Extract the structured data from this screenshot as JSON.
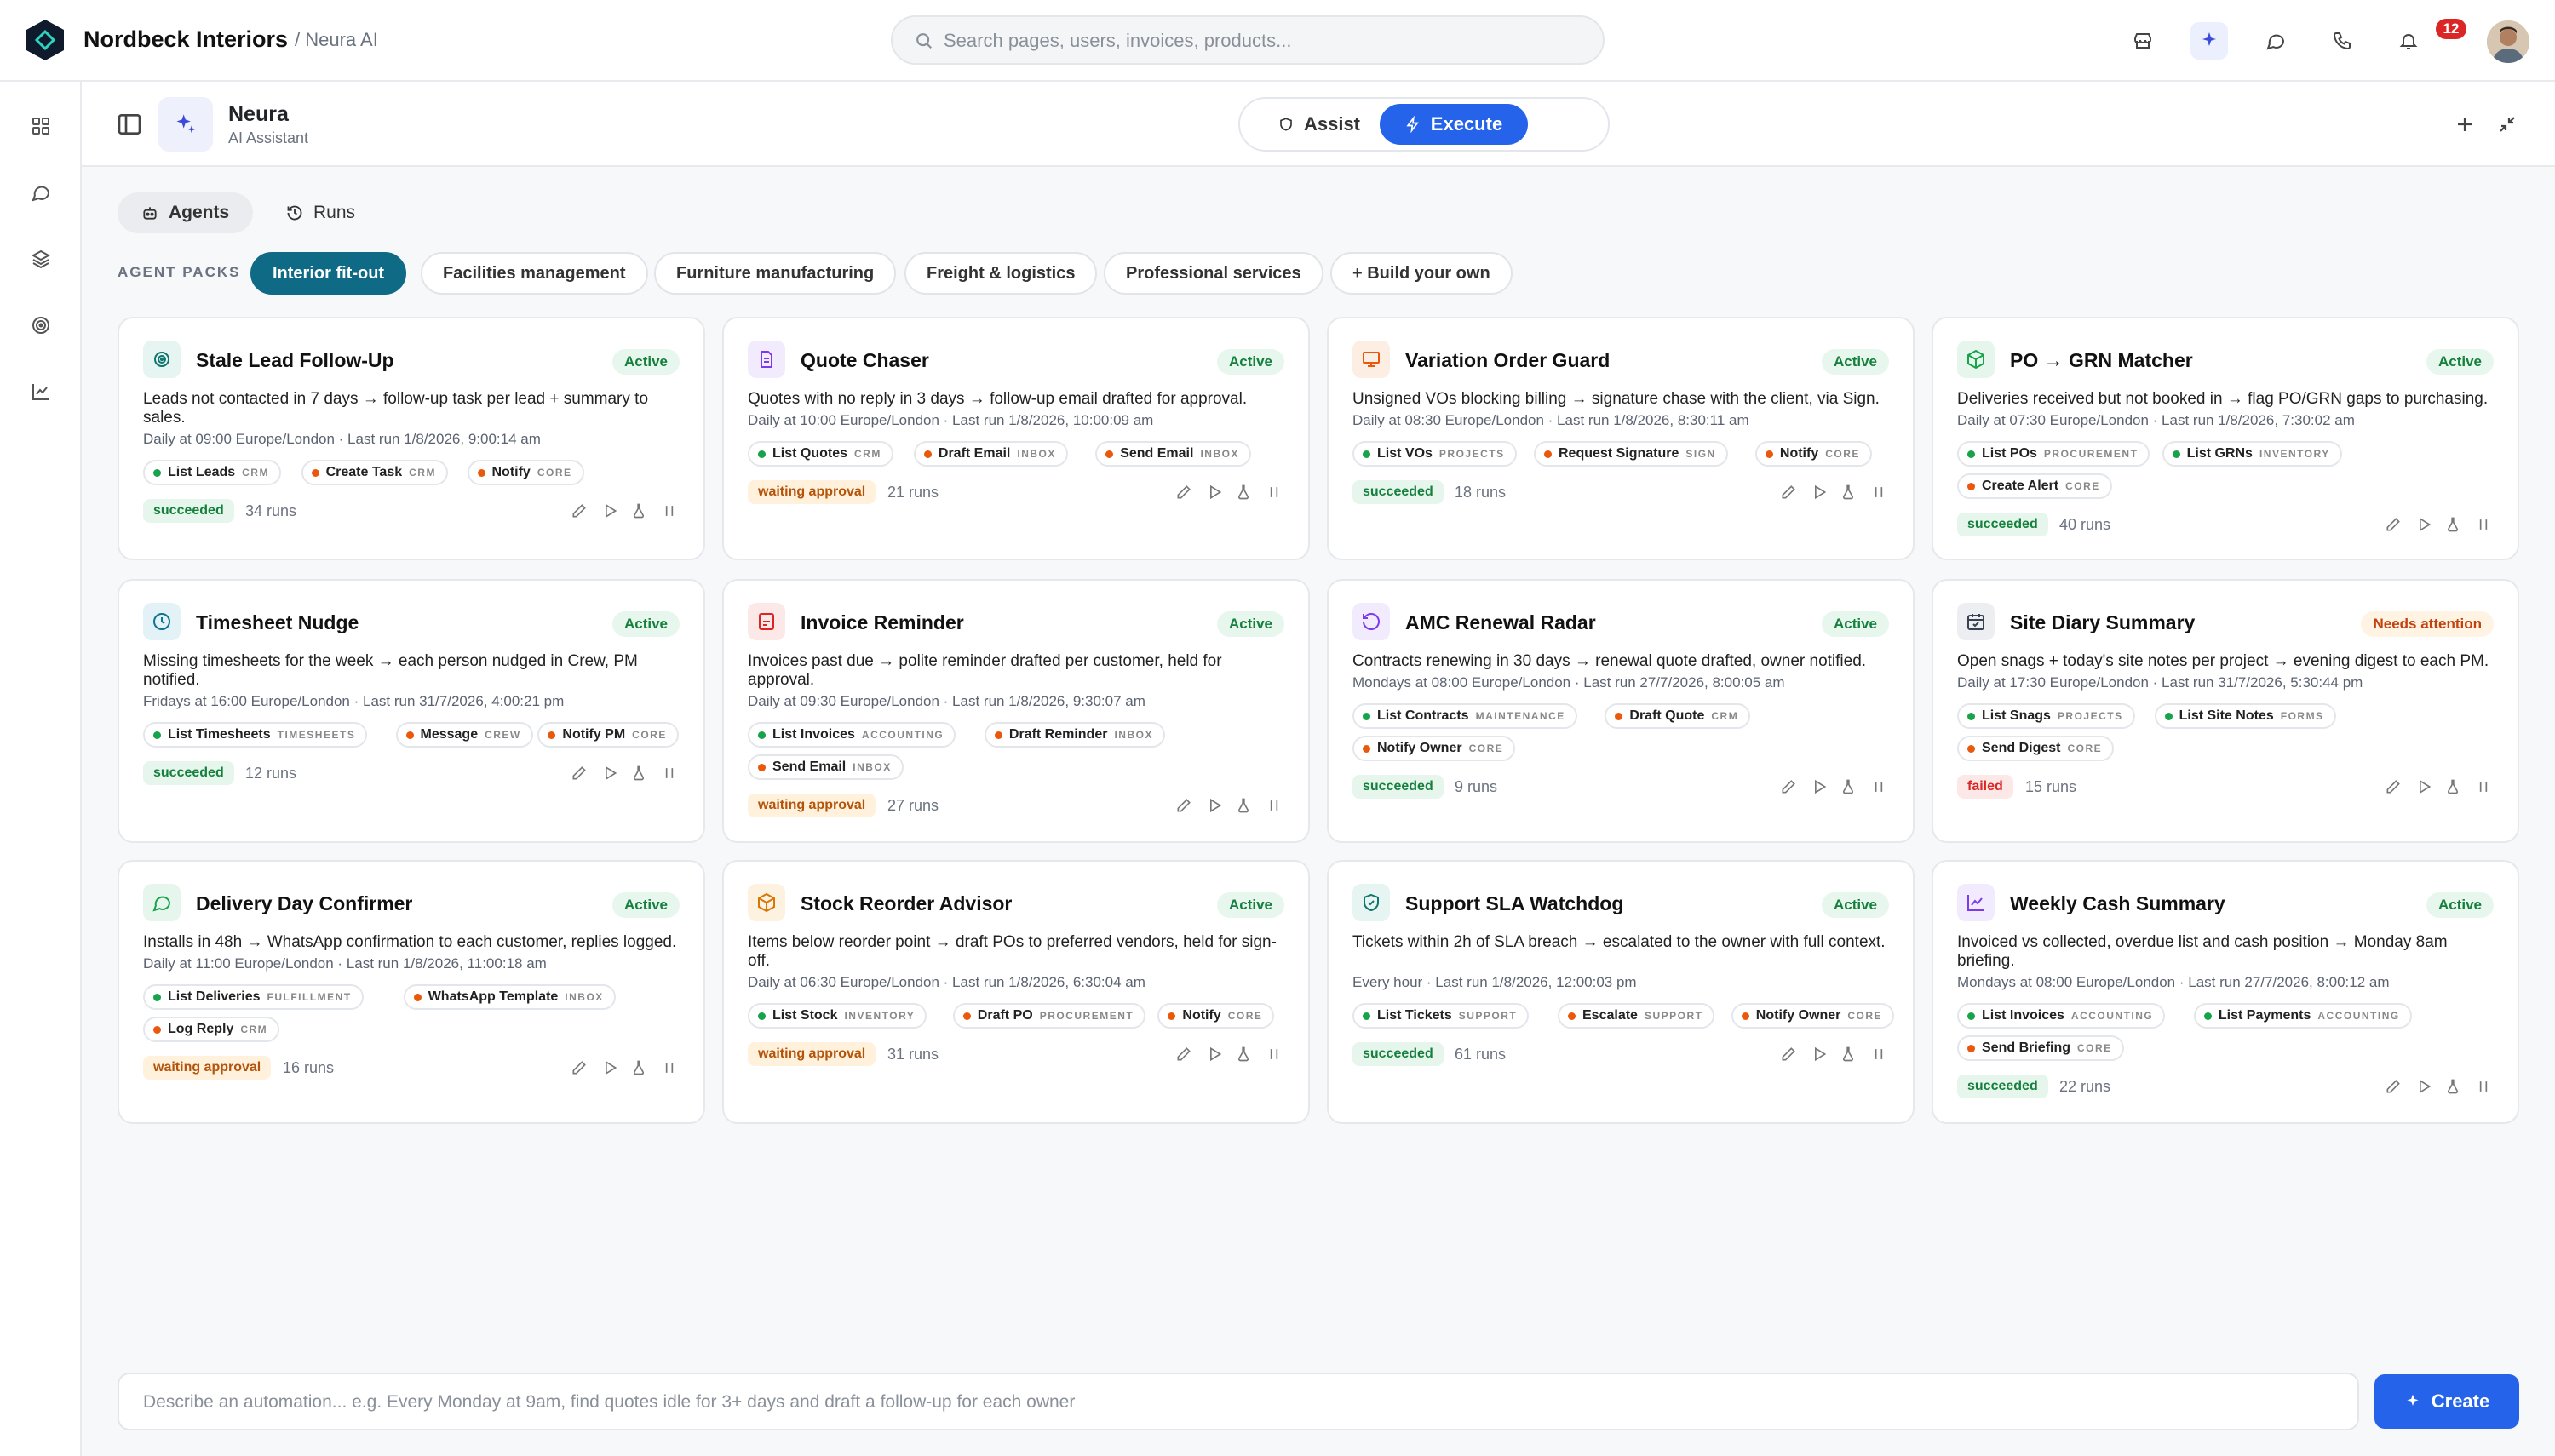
{
  "brand": {
    "name": "Nordbeck Interiors",
    "section": "/ Neura AI"
  },
  "search": {
    "placeholder": "Search pages, users, invoices, products..."
  },
  "notifications": {
    "count": "12"
  },
  "assistant": {
    "title": "Neura",
    "subtitle": "AI Assistant"
  },
  "modes": {
    "assist": "Assist",
    "execute": "Execute",
    "active": "Execute"
  },
  "tabs": {
    "agents": "Agents",
    "runs": "Runs"
  },
  "packs": {
    "label": "AGENT PACKS",
    "items": [
      "Interior fit-out",
      "Facilities management",
      "Furniture manufacturing",
      "Freight & logistics",
      "Professional services",
      "+ Build your own"
    ]
  },
  "agents": [
    {
      "title": "Stale Lead Follow-Up",
      "status": "Active",
      "icon": "target-icon",
      "color": "#0f766e",
      "desc": "Leads not contacted in 7 days → follow-up task per lead + summary to sales.",
      "schedule": "Daily at 09:00 Europe/London · Last run 1/8/2026, 9:00:14 am",
      "tools": [
        [
          "List Leads",
          "CRM",
          "#16a34a"
        ],
        [
          "Create Task",
          "CRM",
          "#ea580c"
        ],
        [
          "Notify",
          "CORE",
          "#ea580c"
        ]
      ],
      "run": "succeeded",
      "runs": "34 runs"
    },
    {
      "title": "Quote Chaser",
      "status": "Active",
      "icon": "document-icon",
      "color": "#7c3aed",
      "desc": "Quotes with no reply in 3 days → follow-up email drafted for approval.",
      "schedule": "Daily at 10:00 Europe/London · Last run 1/8/2026, 10:00:09 am",
      "tools": [
        [
          "List Quotes",
          "CRM",
          "#16a34a"
        ],
        [
          "Draft Email",
          "INBOX",
          "#ea580c"
        ],
        [
          "Send Email",
          "INBOX",
          "#ea580c"
        ]
      ],
      "run": "waiting approval",
      "runs": "21 runs"
    },
    {
      "title": "Variation Order Guard",
      "status": "Active",
      "icon": "presentation-icon",
      "color": "#ea580c",
      "desc": "Unsigned VOs blocking billing → signature chase with the client, via Sign.",
      "schedule": "Daily at 08:30 Europe/London · Last run 1/8/2026, 8:30:11 am",
      "tools": [
        [
          "List VOs",
          "PROJECTS",
          "#16a34a"
        ],
        [
          "Request Signature",
          "SIGN",
          "#ea580c"
        ],
        [
          "Notify",
          "CORE",
          "#ea580c"
        ]
      ],
      "run": "succeeded",
      "runs": "18 runs"
    },
    {
      "title": "PO → GRN Matcher",
      "status": "Active",
      "icon": "package-icon",
      "color": "#16a34a",
      "desc": "Deliveries received but not booked in → flag PO/GRN gaps to purchasing.",
      "schedule": "Daily at 07:30 Europe/London · Last run 1/8/2026, 7:30:02 am",
      "tools": [
        [
          "List POs",
          "PROCUREMENT",
          "#16a34a"
        ],
        [
          "List GRNs",
          "INVENTORY",
          "#16a34a"
        ],
        [
          "Create Alert",
          "CORE",
          "#ea580c"
        ]
      ],
      "run": "succeeded",
      "runs": "40 runs"
    },
    {
      "title": "Timesheet Nudge",
      "status": "Active",
      "icon": "clock-icon",
      "color": "#0e7490",
      "desc": "Missing timesheets for the week → each person nudged in Crew, PM notified.",
      "schedule": "Fridays at 16:00 Europe/London · Last run 31/7/2026, 4:00:21 pm",
      "tools": [
        [
          "List Timesheets",
          "TIMESHEETS",
          "#16a34a"
        ],
        [
          "Message",
          "CREW",
          "#ea580c"
        ],
        [
          "Notify PM",
          "CORE",
          "#ea580c"
        ]
      ],
      "run": "succeeded",
      "runs": "12 runs"
    },
    {
      "title": "Invoice Reminder",
      "status": "Active",
      "icon": "invoice-icon",
      "color": "#dc2626",
      "desc": "Invoices past due → polite reminder drafted per customer, held for approval.",
      "schedule": "Daily at 09:30 Europe/London · Last run 1/8/2026, 9:30:07 am",
      "tools": [
        [
          "List Invoices",
          "ACCOUNTING",
          "#16a34a"
        ],
        [
          "Draft Reminder",
          "INBOX",
          "#ea580c"
        ],
        [
          "Send Email",
          "INBOX",
          "#ea580c"
        ]
      ],
      "run": "waiting approval",
      "runs": "27 runs"
    },
    {
      "title": "AMC Renewal Radar",
      "status": "Active",
      "icon": "refresh-icon",
      "color": "#7c3aed",
      "desc": "Contracts renewing in 30 days → renewal quote drafted, owner notified.",
      "schedule": "Mondays at 08:00 Europe/London · Last run 27/7/2026, 8:00:05 am",
      "tools": [
        [
          "List Contracts",
          "MAINTENANCE",
          "#16a34a"
        ],
        [
          "Draft Quote",
          "CRM",
          "#ea580c"
        ],
        [
          "Notify Owner",
          "CORE",
          "#ea580c"
        ]
      ],
      "run": "succeeded",
      "runs": "9 runs"
    },
    {
      "title": "Site Diary Summary",
      "status": "Needs attention",
      "icon": "calendar-icon",
      "color": "#374151",
      "desc": "Open snags + today's site notes per project → evening digest to each PM.",
      "schedule": "Daily at 17:30 Europe/London · Last run 31/7/2026, 5:30:44 pm",
      "tools": [
        [
          "List Snags",
          "PROJECTS",
          "#16a34a"
        ],
        [
          "List Site Notes",
          "FORMS",
          "#16a34a"
        ],
        [
          "Send Digest",
          "CORE",
          "#ea580c"
        ]
      ],
      "run": "failed",
      "runs": "15 runs"
    },
    {
      "title": "Delivery Day Confirmer",
      "status": "Active",
      "icon": "chat-icon",
      "color": "#16a34a",
      "desc": "Installs in 48h → WhatsApp confirmation to each customer, replies logged.",
      "schedule": "Daily at 11:00 Europe/London · Last run 1/8/2026, 11:00:18 am",
      "tools": [
        [
          "List Deliveries",
          "FULFILLMENT",
          "#16a34a"
        ],
        [
          "WhatsApp Template",
          "INBOX",
          "#ea580c"
        ],
        [
          "Log Reply",
          "CRM",
          "#ea580c"
        ]
      ],
      "run": "waiting approval",
      "runs": "16 runs"
    },
    {
      "title": "Stock Reorder Advisor",
      "status": "Active",
      "icon": "box-icon",
      "color": "#d97706",
      "desc": "Items below reorder point → draft POs to preferred vendors, held for sign-off.",
      "schedule": "Daily at 06:30 Europe/London · Last run 1/8/2026, 6:30:04 am",
      "tools": [
        [
          "List Stock",
          "INVENTORY",
          "#16a34a"
        ],
        [
          "Draft PO",
          "PROCUREMENT",
          "#ea580c"
        ],
        [
          "Notify",
          "CORE",
          "#ea580c"
        ]
      ],
      "run": "waiting approval",
      "runs": "31 runs"
    },
    {
      "title": "Support SLA Watchdog",
      "status": "Active",
      "icon": "shield-icon",
      "color": "#0f766e",
      "desc": "Tickets within 2h of SLA breach → escalated to the owner with full context.",
      "schedule": "Every hour · Last run 1/8/2026, 12:00:03 pm",
      "tools": [
        [
          "List Tickets",
          "SUPPORT",
          "#16a34a"
        ],
        [
          "Escalate",
          "SUPPORT",
          "#ea580c"
        ],
        [
          "Notify Owner",
          "CORE",
          "#ea580c"
        ]
      ],
      "run": "succeeded",
      "runs": "61 runs"
    },
    {
      "title": "Weekly Cash Summary",
      "status": "Active",
      "icon": "chart-icon",
      "color": "#7c3aed",
      "desc": "Invoiced vs collected, overdue list and cash position → Monday 8am briefing.",
      "schedule": "Mondays at 08:00 Europe/London · Last run 27/7/2026, 8:00:12 am",
      "tools": [
        [
          "List Invoices",
          "ACCOUNTING",
          "#16a34a"
        ],
        [
          "List Payments",
          "ACCOUNTING",
          "#16a34a"
        ],
        [
          "Send Briefing",
          "CORE",
          "#ea580c"
        ]
      ],
      "run": "succeeded",
      "runs": "22 runs"
    }
  ],
  "composer": {
    "placeholder": "Describe an automation... e.g. Every Monday at 9am, find quotes idle for 3+ days and draft a follow-up for each owner",
    "button": "Create"
  }
}
